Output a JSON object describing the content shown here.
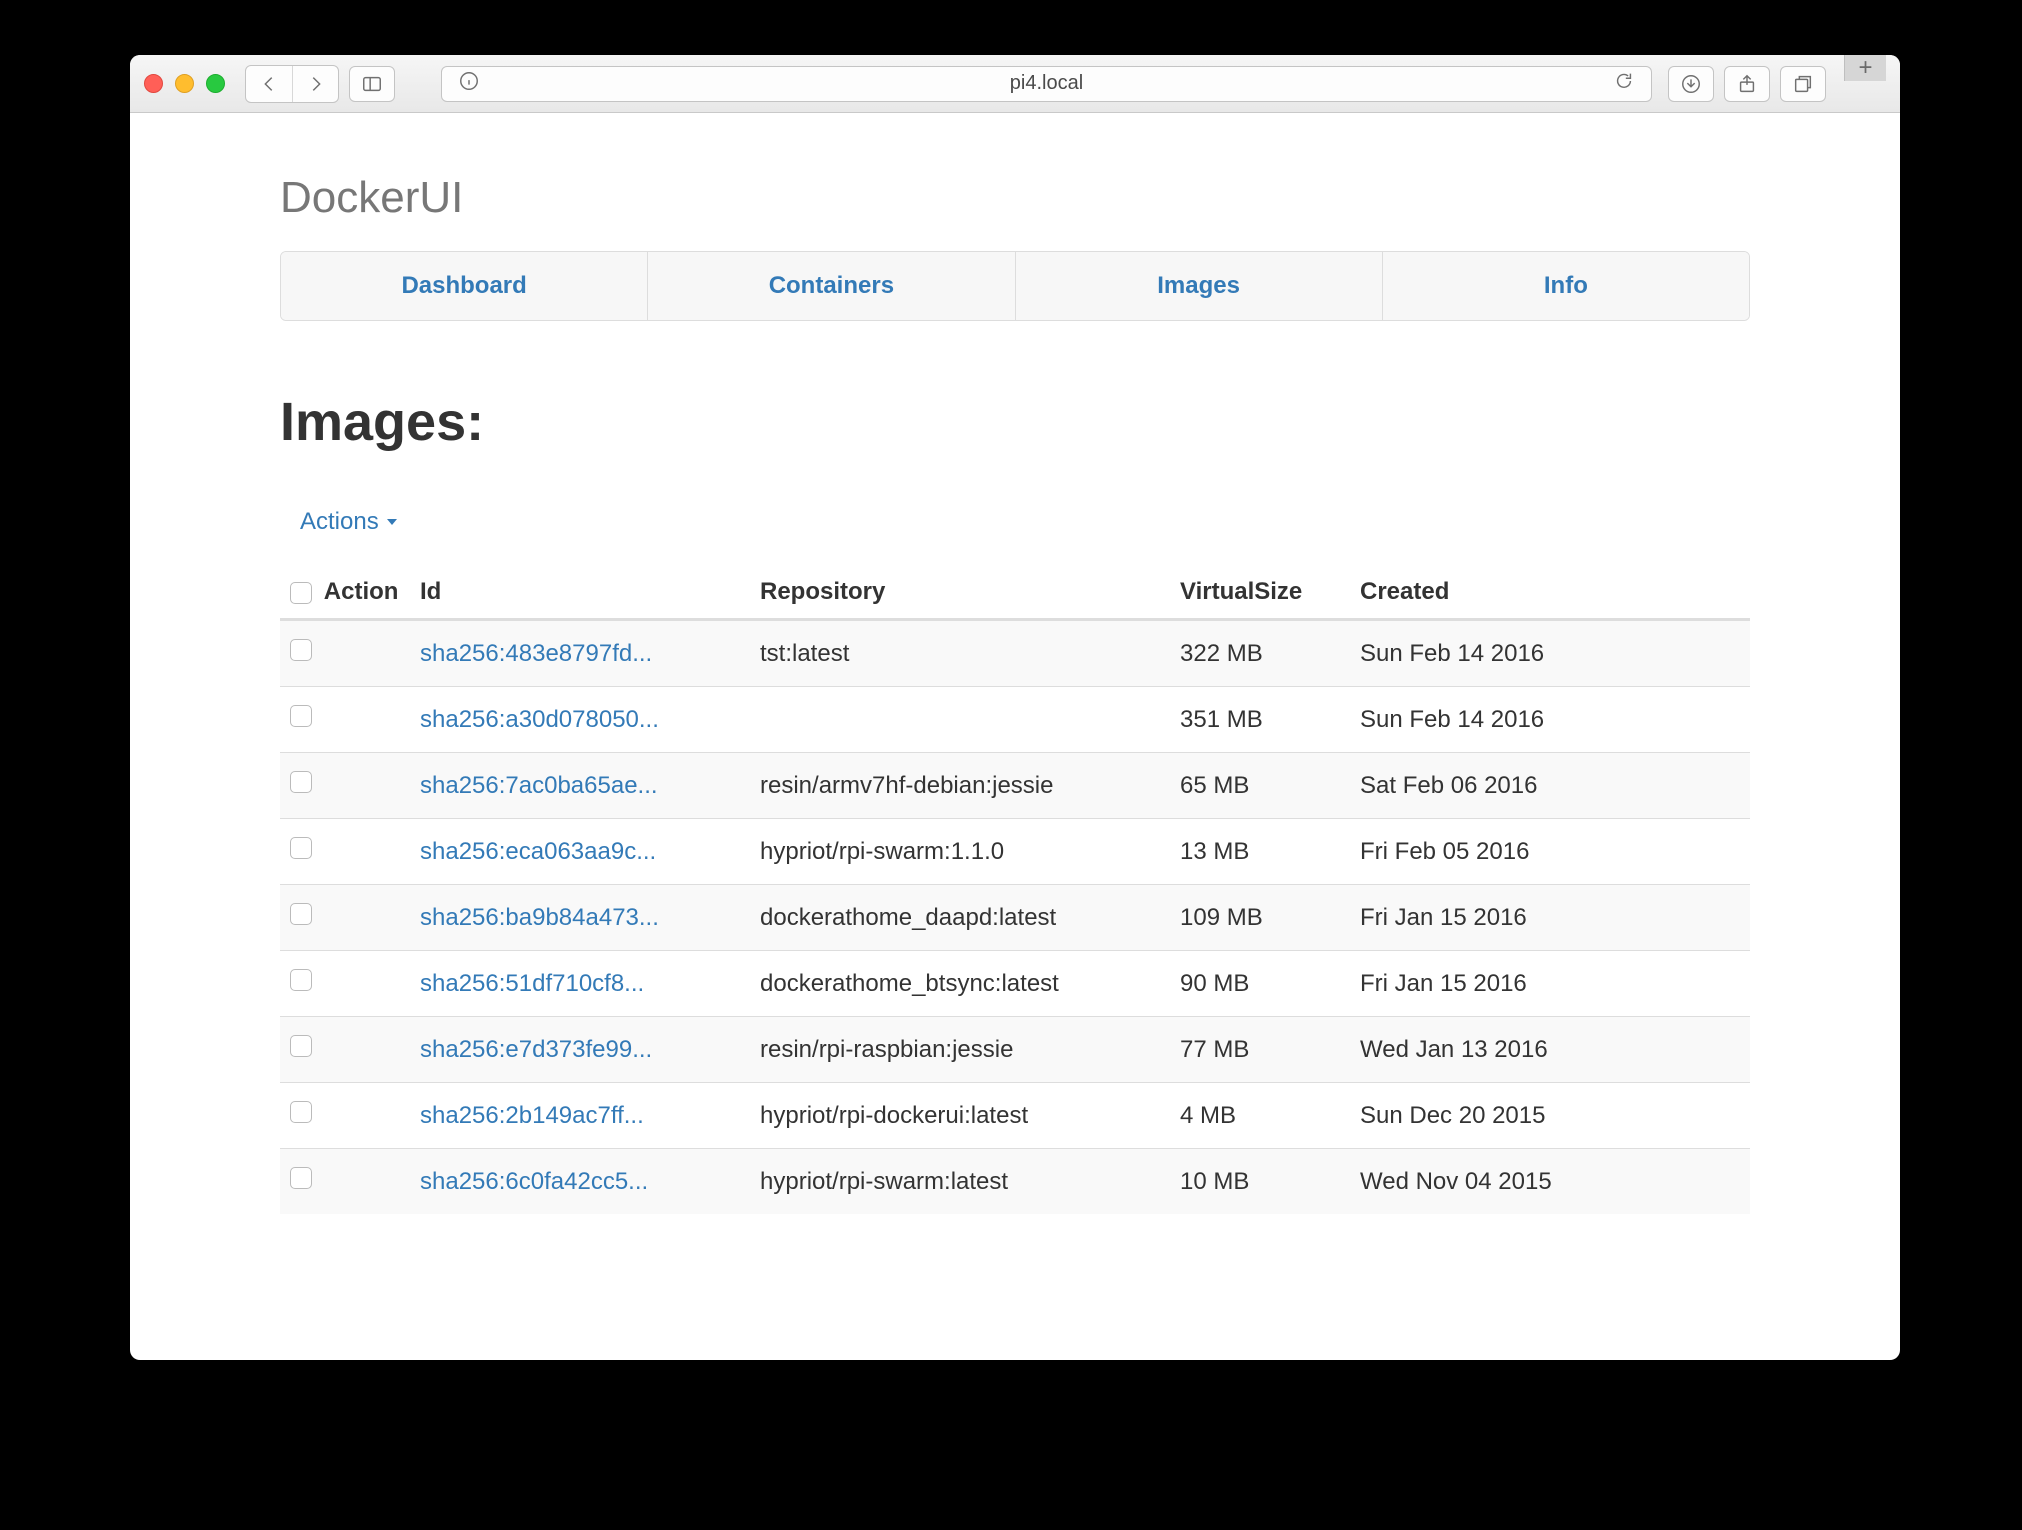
{
  "browser": {
    "address": "pi4.local"
  },
  "app": {
    "title": "DockerUI",
    "nav": [
      "Dashboard",
      "Containers",
      "Images",
      "Info"
    ],
    "page_heading": "Images:",
    "actions_label": "Actions"
  },
  "table": {
    "headers": {
      "action": "Action",
      "id": "Id",
      "repository": "Repository",
      "virtual_size": "VirtualSize",
      "created": "Created"
    },
    "rows": [
      {
        "id": "sha256:483e8797fd...",
        "repository": "tst:latest",
        "size": "322 MB",
        "created": "Sun Feb 14 2016"
      },
      {
        "id": "sha256:a30d078050...",
        "repository": "",
        "size": "351 MB",
        "created": "Sun Feb 14 2016"
      },
      {
        "id": "sha256:7ac0ba65ae...",
        "repository": "resin/armv7hf-debian:jessie",
        "size": "65 MB",
        "created": "Sat Feb 06 2016"
      },
      {
        "id": "sha256:eca063aa9c...",
        "repository": "hypriot/rpi-swarm:1.1.0",
        "size": "13 MB",
        "created": "Fri Feb 05 2016"
      },
      {
        "id": "sha256:ba9b84a473...",
        "repository": "dockerathome_daapd:latest",
        "size": "109 MB",
        "created": "Fri Jan 15 2016"
      },
      {
        "id": "sha256:51df710cf8...",
        "repository": "dockerathome_btsync:latest",
        "size": "90 MB",
        "created": "Fri Jan 15 2016"
      },
      {
        "id": "sha256:e7d373fe99...",
        "repository": "resin/rpi-raspbian:jessie",
        "size": "77 MB",
        "created": "Wed Jan 13 2016"
      },
      {
        "id": "sha256:2b149ac7ff...",
        "repository": "hypriot/rpi-dockerui:latest",
        "size": "4 MB",
        "created": "Sun Dec 20 2015"
      },
      {
        "id": "sha256:6c0fa42cc5...",
        "repository": "hypriot/rpi-swarm:latest",
        "size": "10 MB",
        "created": "Wed Nov 04 2015"
      }
    ]
  }
}
